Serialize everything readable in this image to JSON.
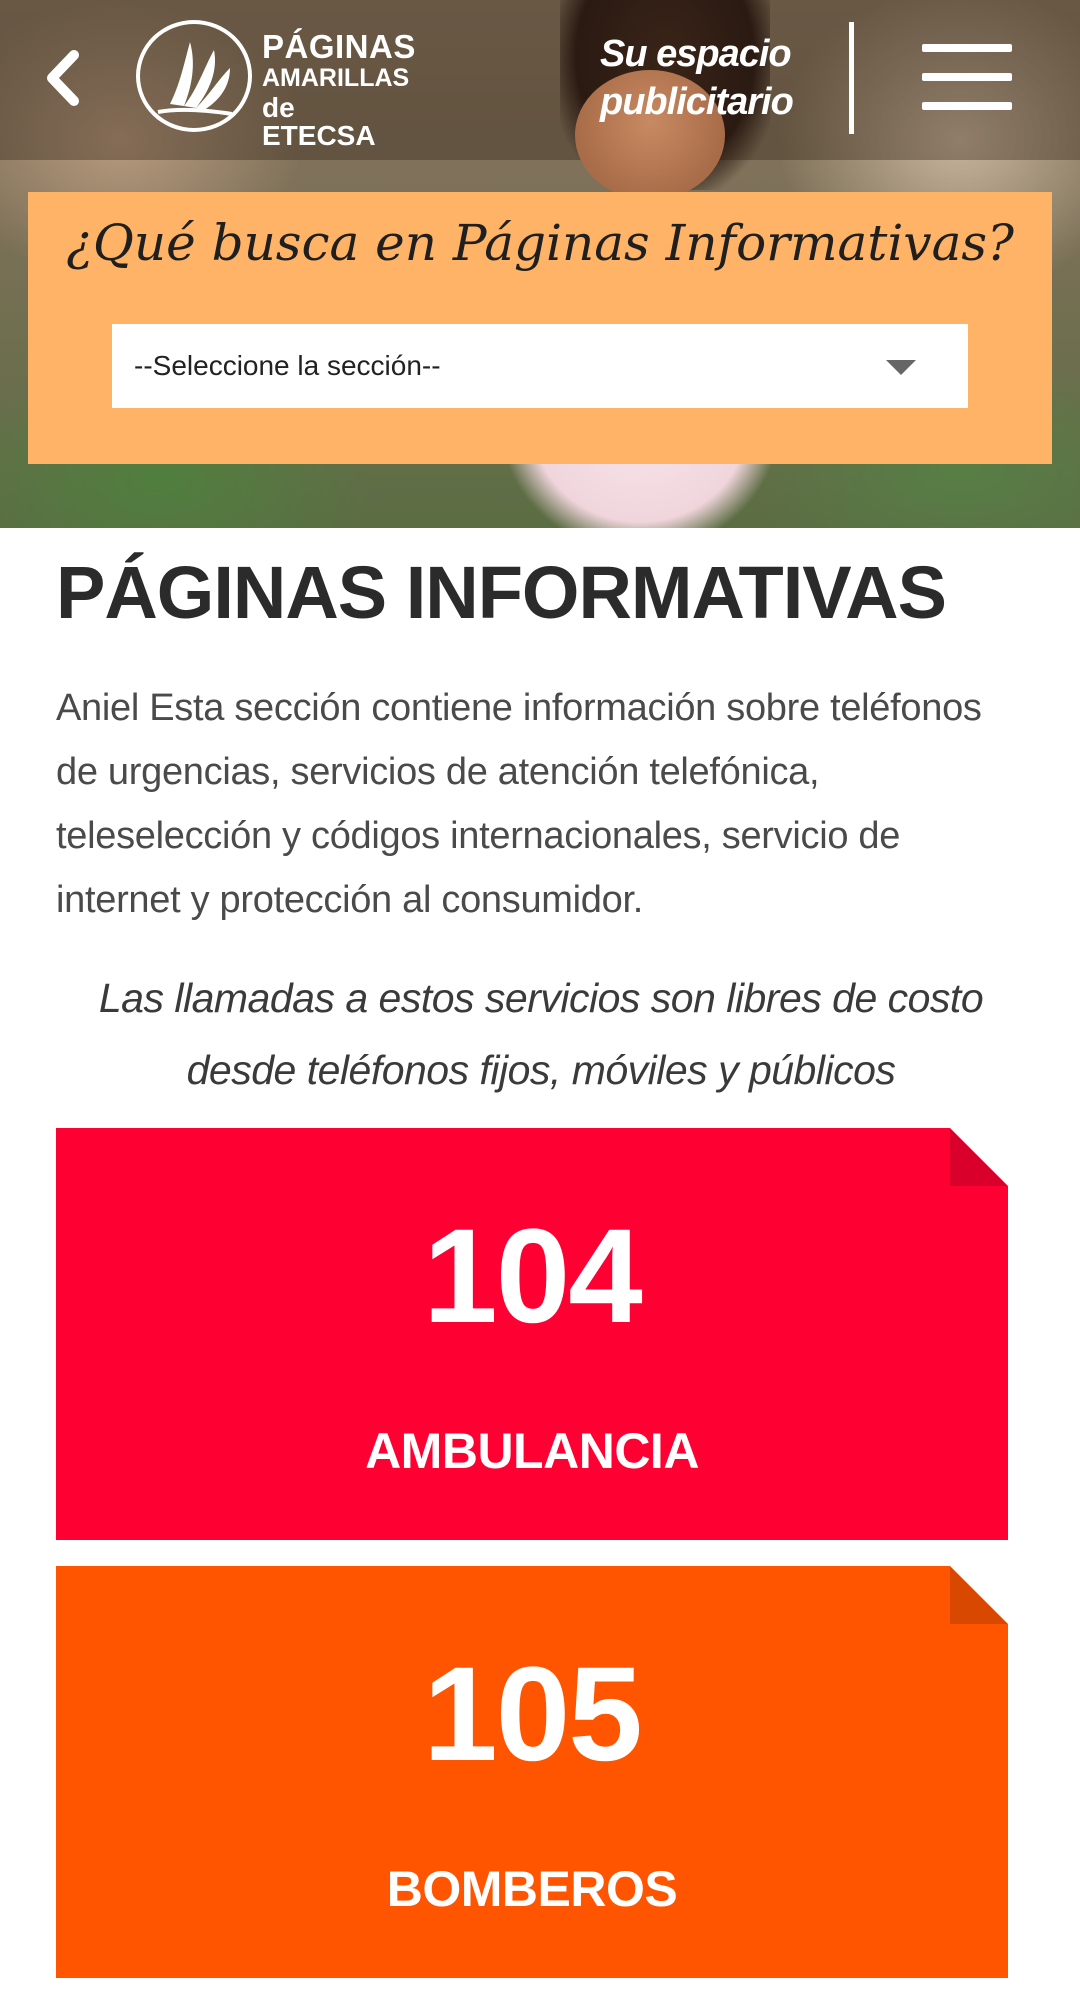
{
  "header": {
    "logo": {
      "line1": "PÁGINAS",
      "line2": "AMARILLAS",
      "line3": "de ETECSA"
    },
    "ad_link_line1": "Su espacio",
    "ad_link_line2": "publicitario"
  },
  "search": {
    "title": "¿Qué busca en Páginas Informativas?",
    "select_value": "--Seleccione la sección--"
  },
  "main": {
    "title": "PÁGINAS INFORMATIVAS",
    "intro": "Aniel Esta sección contiene información sobre teléfonos de urgencias, servicios de atención telefónica, teleselección y códigos internacionales, servicio de internet y protección al consumidor.",
    "notice_line1": "Las llamadas a estos servicios son libres de costo",
    "notice_line2": "desde teléfonos fijos, móviles y públicos"
  },
  "services": [
    {
      "number": "104",
      "label": "AMBULANCIA",
      "color": "#ff0033",
      "fold_color": "#d9002b"
    },
    {
      "number": "105",
      "label": "BOMBEROS",
      "color": "#ff5500",
      "fold_color": "#d84800"
    }
  ],
  "icons": {
    "back": "chevron-left-icon",
    "menu": "hamburger-menu-icon",
    "select": "caret-down-icon"
  }
}
